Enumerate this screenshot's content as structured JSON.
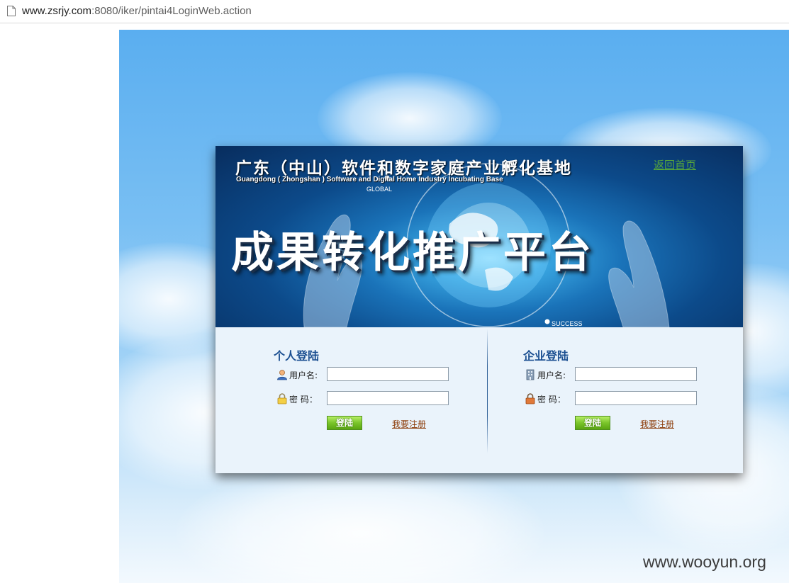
{
  "browser": {
    "url_host": "www.zsrjy.com",
    "url_rest": ":8080/iker/pintai4LoginWeb.action"
  },
  "banner": {
    "title": "广东（中山）软件和数字家庭产业孵化基地",
    "subtitle": "Guangdong ( Zhongshan ) Software and Digital Home Industry Incubating Base",
    "global_label": "GLOBAL",
    "success_label": "SUCCESS",
    "main_title": "成果转化推广平台",
    "home_link": "返回首页"
  },
  "personal_login": {
    "title": "个人登陆",
    "username_label": "用户名:",
    "password_label": "密 码：",
    "username_value": "",
    "password_value": "",
    "login_button": "登陆",
    "register_link": "我要注册"
  },
  "enterprise_login": {
    "title": "企业登陆",
    "username_label": "用户名:",
    "password_label": "密 码：",
    "username_value": "",
    "password_value": "",
    "login_button": "登陆",
    "register_link": "我要注册"
  },
  "watermark": "www.wooyun.org",
  "colors": {
    "section_title": "#1b4f91",
    "home_link": "#57a63a",
    "register_link": "#8b3a07",
    "login_button": "#7ac52a"
  },
  "icons": {
    "page": "document-icon",
    "personal_user": "person-icon",
    "personal_password": "lock-icon",
    "enterprise_user": "building-icon",
    "enterprise_password": "lock-icon"
  }
}
